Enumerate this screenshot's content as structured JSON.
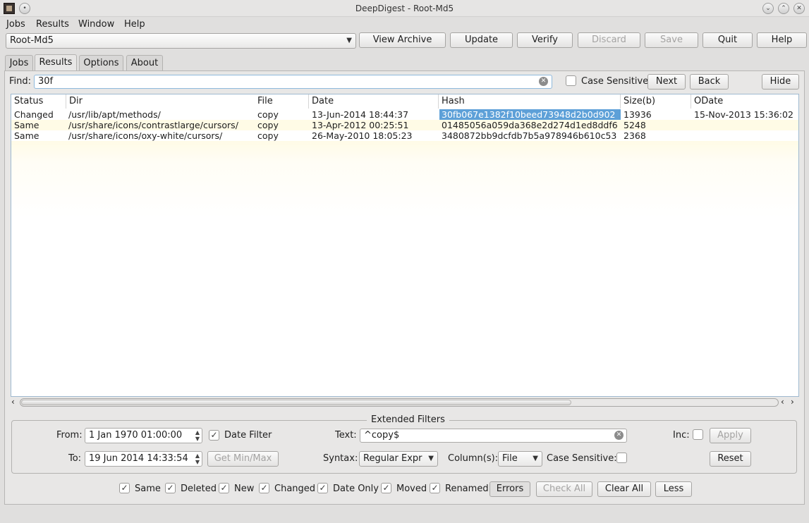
{
  "window": {
    "title": "DeepDigest - Root-Md5"
  },
  "menu": [
    "Jobs",
    "Results",
    "Window",
    "Help"
  ],
  "toolbar": {
    "job_select": "Root-Md5",
    "buttons": [
      "View Archive",
      "Update",
      "Verify",
      "Discard",
      "Save",
      "Quit",
      "Help"
    ]
  },
  "tabs": [
    "Jobs",
    "Results",
    "Options",
    "About"
  ],
  "find": {
    "label": "Find:",
    "value": "30f",
    "case_sensitive_label": "Case Sensitive",
    "next_label": "Next",
    "back_label": "Back",
    "hide_label": "Hide"
  },
  "table": {
    "columns": [
      "Status",
      "Dir",
      "File",
      "Date",
      "Hash",
      "Size(b)",
      "ODate"
    ],
    "rows": [
      [
        "Changed",
        "/usr/lib/apt/methods/",
        "copy",
        "13-Jun-2014 18:44:37",
        "30fb067e1382f10beed73948d2b0d902",
        "13936",
        "15-Nov-2013 15:36:02"
      ],
      [
        "Same",
        "/usr/share/icons/contrastlarge/cursors/",
        "copy",
        "13-Apr-2012 00:25:51",
        "01485056a059da368e2d274d1ed8ddf6",
        "5248",
        ""
      ],
      [
        "Same",
        "/usr/share/icons/oxy-white/cursors/",
        "copy",
        "26-May-2010 18:05:23",
        "3480872bb9dcfdb7b5a978946b610c53",
        "2368",
        ""
      ]
    ]
  },
  "filters": {
    "title": "Extended Filters",
    "from_label": "From:",
    "from_value": "1 Jan 1970 01:00:00",
    "to_label": "To:",
    "to_value": "19 Jun 2014 14:33:54",
    "date_filter_label": "Date Filter",
    "get_minmax_label": "Get Min/Max",
    "text_label": "Text:",
    "text_value": "^copy$",
    "syntax_label": "Syntax:",
    "syntax_value": "Regular Expr",
    "columns_label": "Column(s):",
    "columns_value": "File",
    "case_sensitive_label": "Case Sensitive:",
    "inc_label": "Inc:",
    "apply_label": "Apply",
    "reset_label": "Reset"
  },
  "bottom": {
    "checks": [
      "Same",
      "Deleted",
      "New",
      "Changed",
      "Date Only",
      "Moved",
      "Renamed"
    ],
    "errors_label": "Errors",
    "check_all_label": "Check All",
    "clear_all_label": "Clear All",
    "less_label": "Less"
  },
  "colors": {
    "selection": "#5da0d8",
    "row_alt": "#fffbe6",
    "accent_border": "#8fb9dc"
  }
}
